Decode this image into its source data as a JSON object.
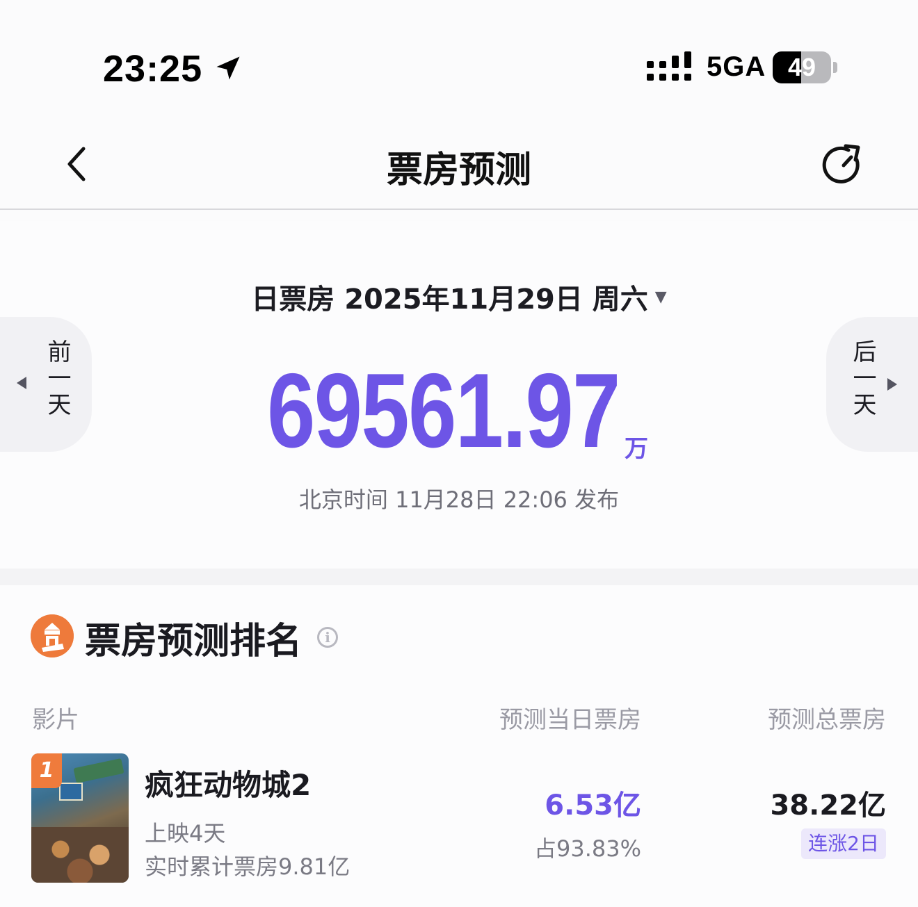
{
  "status_bar": {
    "time": "23:25",
    "network": "5GA",
    "battery_level": "49",
    "battery_fraction": 0.49,
    "icons": [
      "location-arrow-icon",
      "signal-bars-icon",
      "battery-icon"
    ]
  },
  "nav": {
    "title": "票房预测",
    "back_icon": "chevron-left-icon",
    "refresh_icon": "refresh-icon"
  },
  "summary": {
    "date_selector": "日票房 2025年11月29日 周六",
    "prev_day_label": "前一天",
    "next_day_label": "后一天",
    "total": "69561.97",
    "total_unit": "万",
    "publish_time": "北京时间 11月28日 22:06 发布",
    "accent_color": "#6d55e6"
  },
  "ranking": {
    "title": "票房预测排名",
    "headers": {
      "film": "影片",
      "daily": "预测当日票房",
      "total": "预测总票房"
    },
    "movies": [
      {
        "rank": "1",
        "title": "疯狂动物城2",
        "days_showing": "上映4天",
        "cumulative": "实时累计票房9.81亿",
        "daily_value": "6.53亿",
        "daily_share": "占93.83%",
        "total_value": "38.22亿",
        "trend": "连涨2日"
      }
    ]
  }
}
